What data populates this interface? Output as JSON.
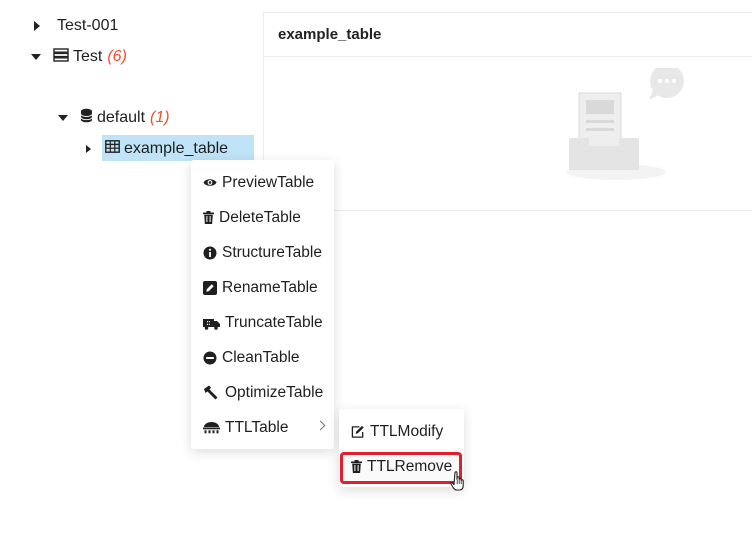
{
  "tree": {
    "root_item": {
      "label": "Test-001"
    },
    "cluster": {
      "label": "Test",
      "count": "(6)"
    },
    "database": {
      "label": "default",
      "count": "(1)"
    },
    "table": {
      "label": "example_table"
    }
  },
  "panel": {
    "title": "example_table"
  },
  "context_menu": {
    "items": [
      {
        "label": "PreviewTable",
        "icon": "eye-icon"
      },
      {
        "label": "DeleteTable",
        "icon": "trash-icon"
      },
      {
        "label": "StructureTable",
        "icon": "info-icon"
      },
      {
        "label": "RenameTable",
        "icon": "edit-icon"
      },
      {
        "label": "TruncateTable",
        "icon": "truncate-icon"
      },
      {
        "label": "CleanTable",
        "icon": "minus-circle-icon"
      },
      {
        "label": "OptimizeTable",
        "icon": "hammer-icon"
      },
      {
        "label": "TTLTable",
        "icon": "ttl-icon"
      }
    ]
  },
  "submenu": {
    "items": [
      {
        "label": "TTLModify",
        "icon": "edit-outline-icon"
      },
      {
        "label": "TTLRemove",
        "icon": "trash-icon"
      }
    ]
  },
  "colors": {
    "selected_bg": "#bfe3f7",
    "count": "#e8542f",
    "highlight": "#e0202c"
  }
}
